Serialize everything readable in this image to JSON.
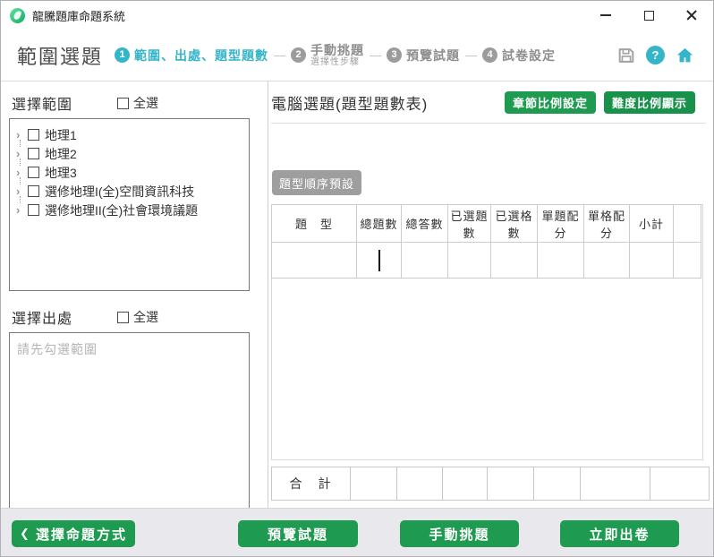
{
  "window": {
    "title": "龍騰題庫命題系統"
  },
  "header": {
    "page_title": "範圍選題",
    "separator": "—",
    "steps": [
      {
        "num": "1",
        "label": "範圍、出處、題型題數",
        "sublabel": ""
      },
      {
        "num": "2",
        "label": "手動挑題",
        "sublabel": "選擇性步驟"
      },
      {
        "num": "3",
        "label": "預覽試題",
        "sublabel": ""
      },
      {
        "num": "4",
        "label": "試卷設定",
        "sublabel": ""
      }
    ],
    "help_glyph": "?"
  },
  "left": {
    "range": {
      "title": "選擇範圍",
      "select_all": "全選",
      "expander": "›",
      "items": [
        "地理1",
        "地理2",
        "地理3",
        "選修地理I(全)空間資訊科技",
        "選修地理II(全)社會環境議題"
      ]
    },
    "source": {
      "title": "選擇出處",
      "select_all": "全選",
      "placeholder": "請先勾選範圍"
    }
  },
  "main": {
    "title": "電腦選題(題型題數表)",
    "chapter_ratio_button": "章節比例設定",
    "difficulty_ratio_button": "難度比例顯示",
    "type_order_button": "題型順序預設",
    "table": {
      "headers": [
        "題　型",
        "總題數",
        "總答數",
        "已選題數",
        "已選格數",
        "單題配分",
        "單格配分",
        "小計",
        ""
      ],
      "row": [
        "",
        "",
        "",
        "",
        "",
        "",
        "",
        "",
        ""
      ],
      "total_label": "合　計"
    }
  },
  "footer": {
    "back_icon": "❮",
    "back": "選擇命題方式",
    "preview": "預覽試題",
    "manual": "手動挑題",
    "generate": "立即出卷"
  },
  "colors": {
    "teal": "#35b5c8",
    "green": "#1e9b50",
    "gray_button": "#9e9e9e"
  }
}
